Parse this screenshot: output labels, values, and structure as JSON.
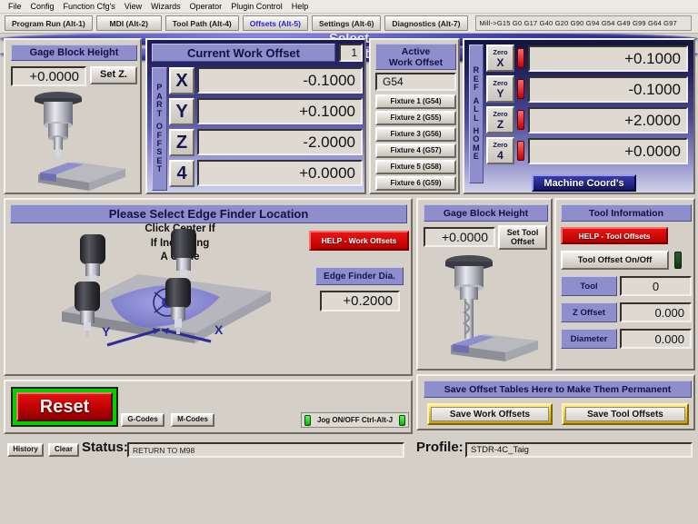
{
  "menubar": {
    "items": [
      "File",
      "Config",
      "Function Cfg's",
      "View",
      "Wizards",
      "Operator",
      "Plugin Control",
      "Help"
    ]
  },
  "tabbar": {
    "tabs": [
      {
        "label": "Program Run (Alt-1)",
        "active": false
      },
      {
        "label": "MDI (Alt-2)",
        "active": false
      },
      {
        "label": "Tool Path (Alt-4)",
        "active": false
      },
      {
        "label": "Offsets (Alt-5)",
        "active": true
      },
      {
        "label": "Settings (Alt-6)",
        "active": false
      },
      {
        "label": "Diagnostics (Alt-7)",
        "active": false
      }
    ],
    "gcode_line": "Mill->G15   G0 G17 G40 G20 G90 G94 G54 G49 G99 G64 G97"
  },
  "gage_block_top": {
    "title": "Gage Block Height",
    "value": "+0.0000",
    "set_z_label": "Set Z."
  },
  "current_work_offset": {
    "title": "Current Work Offset",
    "index": "1",
    "side_label": "PART OFFSET",
    "side_label_chars": [
      "P",
      "A",
      "R",
      "T",
      "",
      "O",
      "F",
      "F",
      "S",
      "E",
      "T"
    ],
    "axes": [
      {
        "name": "X",
        "value": "-0.1000"
      },
      {
        "name": "Y",
        "value": "+0.1000"
      },
      {
        "name": "Z",
        "value": "-2.0000"
      },
      {
        "name": "4",
        "value": "+0.0000"
      }
    ]
  },
  "active_work_offset": {
    "title_line1": "Active",
    "title_line2": "Work Offset",
    "current": "G54",
    "fixtures": [
      "Fixture 1 (G54)",
      "Fixture 2 (G55)",
      "Fixture 3 (G56)",
      "Fixture 4 (G57)",
      "Fixture 5 (G58)",
      "Fixture 6 (G59)"
    ]
  },
  "machine_dro": {
    "side_label_chars": [
      "R",
      "E",
      "F",
      "",
      "A",
      "L",
      "L",
      "",
      "H",
      "O",
      "M",
      "E"
    ],
    "zero_prefix": "Zero",
    "axes": [
      {
        "name": "X",
        "value": "+0.1000",
        "led": "red"
      },
      {
        "name": "Y",
        "value": "-0.1000",
        "led": "red"
      },
      {
        "name": "Z",
        "value": "+2.0000",
        "led": "red"
      },
      {
        "name": "4",
        "value": "+0.0000",
        "led": "red"
      }
    ],
    "machine_coords_label": "Machine Coord's"
  },
  "edge_finder": {
    "title": "Please Select Edge Finder Location",
    "note_lines": [
      "Click Center If",
      "If Indicating",
      "A Circle"
    ],
    "select_label": "Select",
    "help_label": "HELP - Work Offsets",
    "dia_label": "Edge Finder Dia.",
    "dia_value": "+0.2000",
    "axis_labels": [
      "Y",
      "X"
    ]
  },
  "gage_block_tool": {
    "title": "Gage Block Height",
    "value": "+0.0000",
    "set_tool_offset_label": "Set Tool Offset"
  },
  "tool_information": {
    "title": "Tool Information",
    "help_label": "HELP - Tool Offsets",
    "toggle_label": "Tool Offset On/Off",
    "rows": [
      {
        "label": "Tool",
        "value": "0"
      },
      {
        "label": "Z Offset",
        "value": "0.000"
      },
      {
        "label": "Diameter",
        "value": "0.000"
      }
    ]
  },
  "controls": {
    "reset_label": "Reset",
    "gcodes_label": "G-Codes",
    "mcodes_label": "M-Codes",
    "jog_label": "Jog ON/OFF Ctrl-Alt-J"
  },
  "save_offsets": {
    "title": "Save Offset Tables Here to Make Them Permanent",
    "save_work_label": "Save Work Offsets",
    "save_tool_label": "Save Tool Offsets"
  },
  "statusbar": {
    "history_label": "History",
    "clear_label": "Clear",
    "status_label": "Status:",
    "status_value": "RETURN TO M98",
    "profile_label": "Profile:",
    "profile_value": "STDR-4C_Taig"
  },
  "colors": {
    "header_lavender": "#8e8ecd",
    "panel_face": "#d4d0c8",
    "dro_face": "#dedad2",
    "active_tab_text": "#2326d6",
    "red_alert": "#c20202",
    "gold": "#e8c63c",
    "led_red": "#c20000",
    "led_green": "#0bab0b"
  }
}
